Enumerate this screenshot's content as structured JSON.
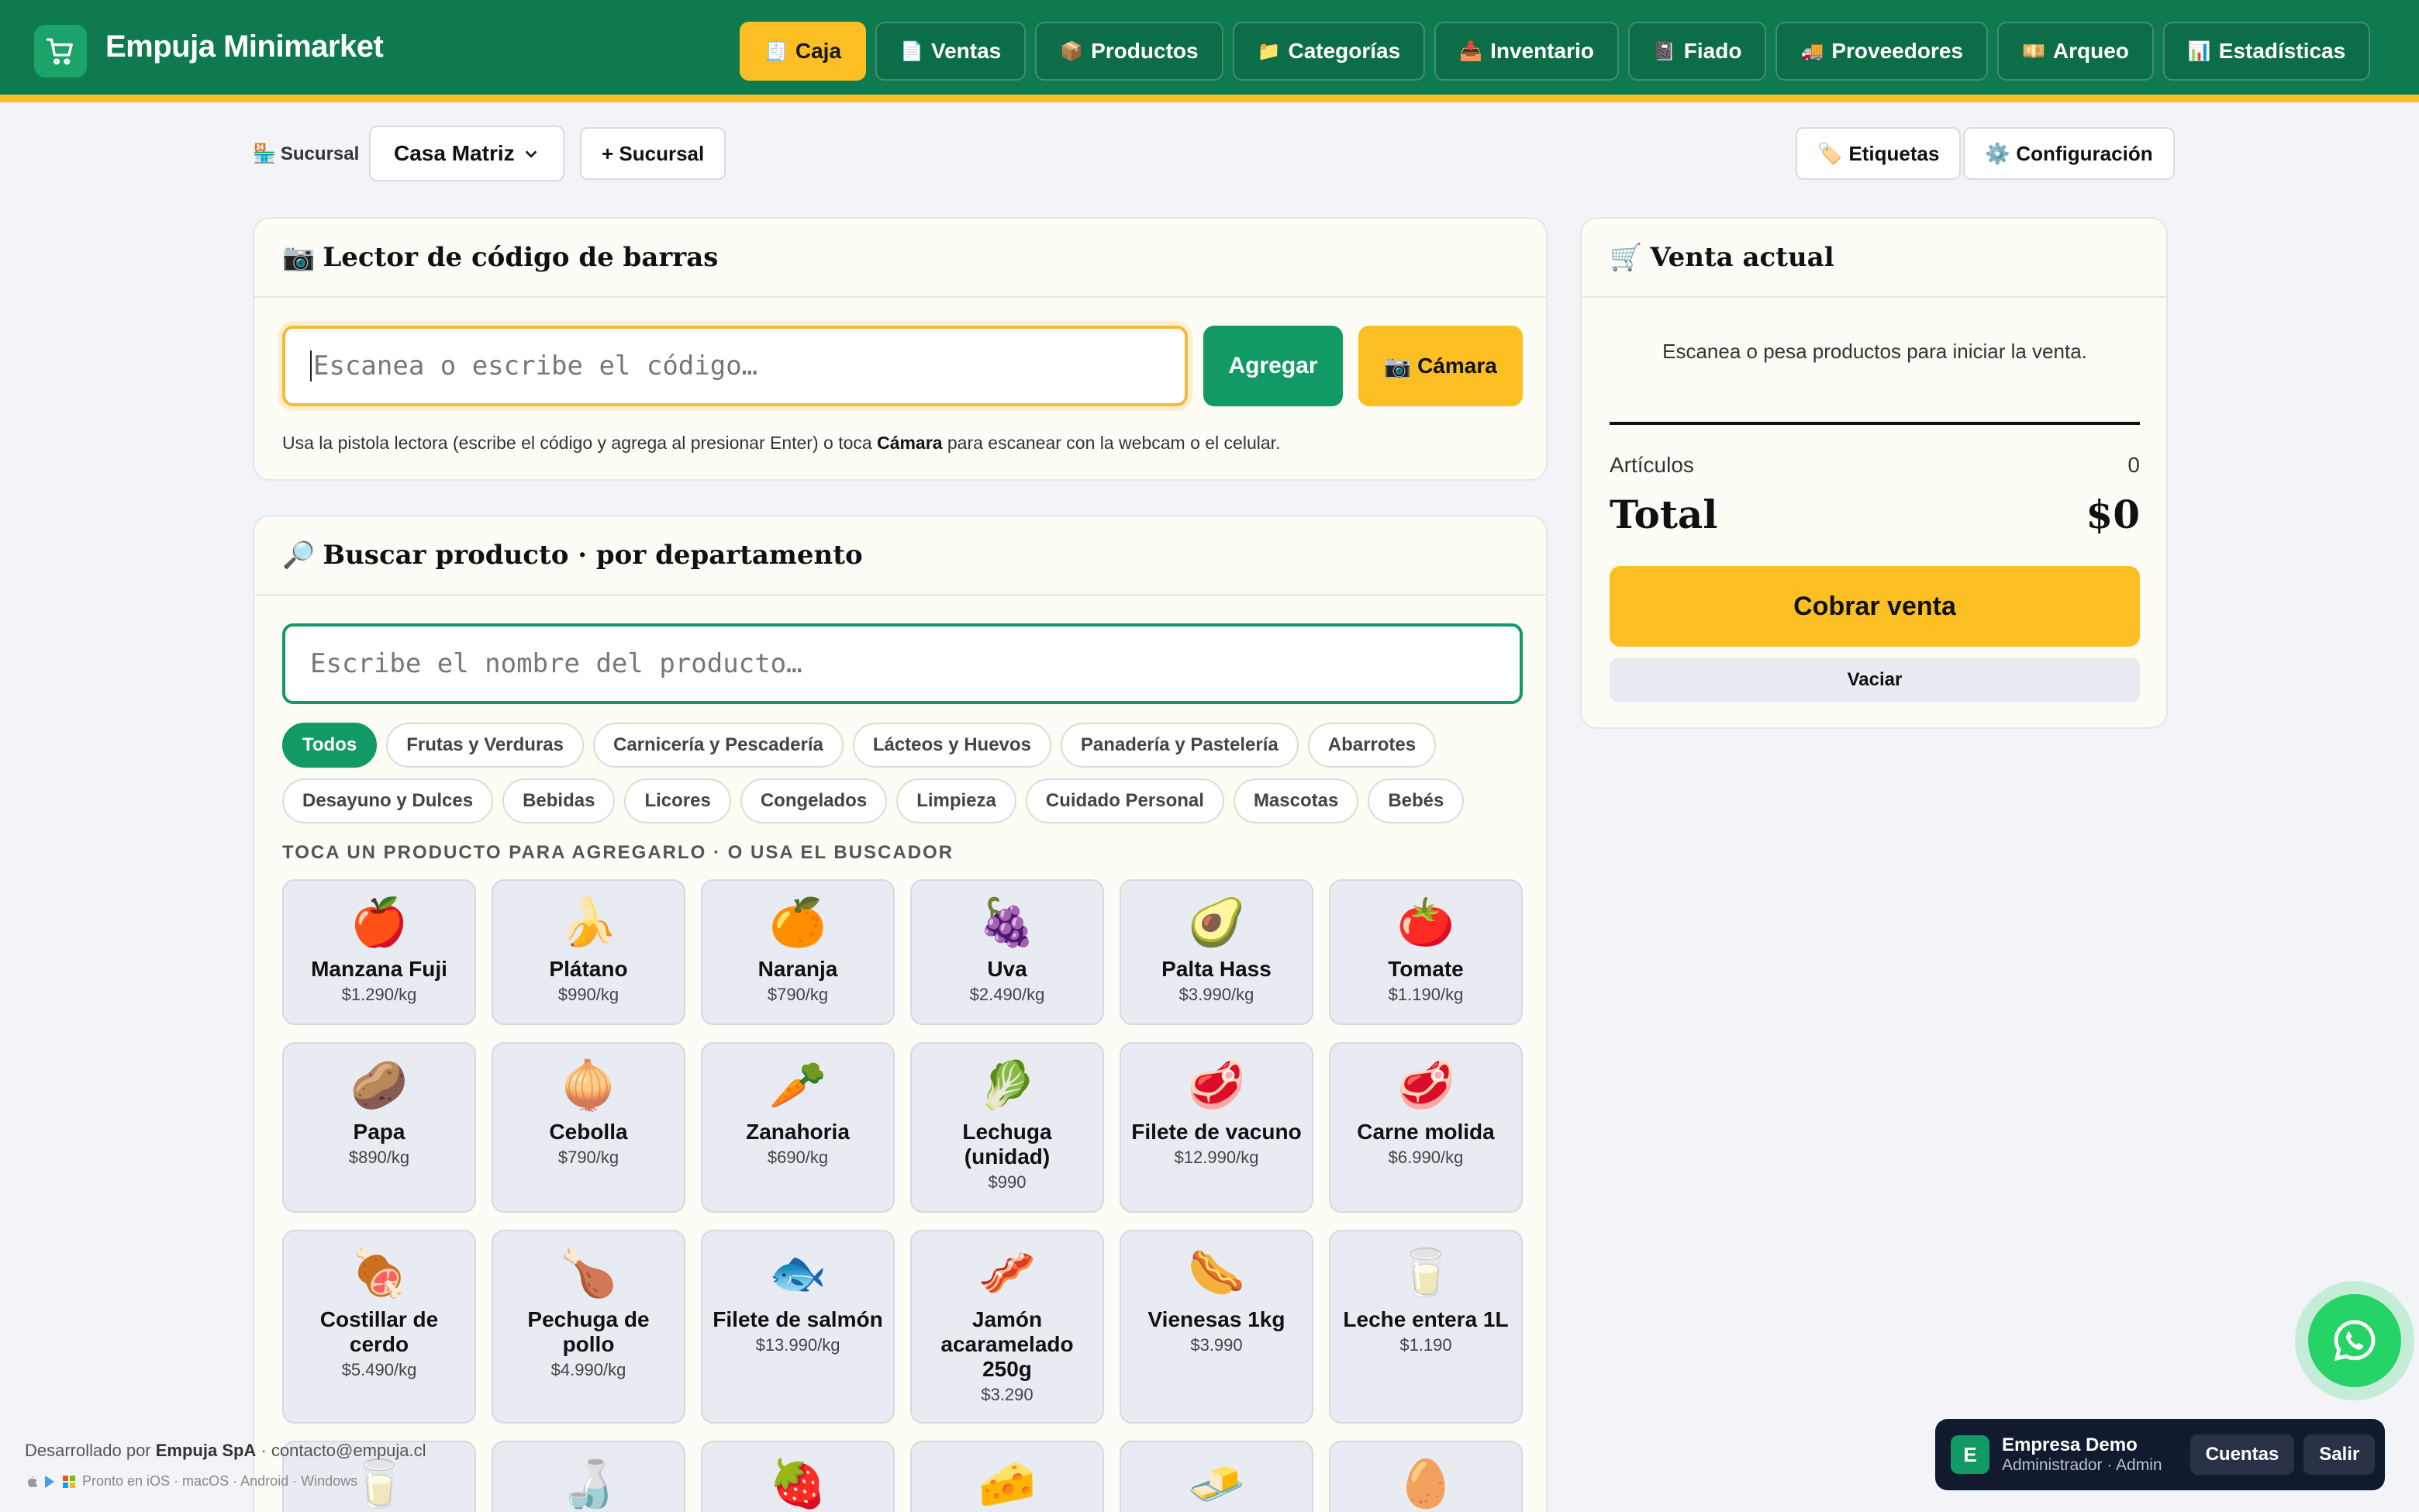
{
  "header": {
    "brand": "Empuja Minimarket",
    "nav": [
      {
        "icon": "🧾",
        "label": "Caja",
        "active": true
      },
      {
        "icon": "📄",
        "label": "Ventas"
      },
      {
        "icon": "📦",
        "label": "Productos"
      },
      {
        "icon": "📁",
        "label": "Categorías"
      },
      {
        "icon": "📥",
        "label": "Inventario"
      },
      {
        "icon": "📓",
        "label": "Fiado"
      },
      {
        "icon": "🚚",
        "label": "Proveedores"
      },
      {
        "icon": "💴",
        "label": "Arqueo"
      },
      {
        "icon": "📊",
        "label": "Estadísticas"
      }
    ]
  },
  "toolbar": {
    "branch_icon": "🏪",
    "branch_label": "Sucursal",
    "branch_value": "Casa Matriz",
    "add_branch": "+ Sucursal",
    "labels_icon": "🏷️",
    "labels_btn": "Etiquetas",
    "config_icon": "⚙️",
    "config_btn": "Configuración"
  },
  "scanner": {
    "icon": "📷",
    "title": "Lector de código de barras",
    "placeholder": "Escanea o escribe el código…",
    "add_btn": "Agregar",
    "cam_icon": "📷",
    "cam_btn": "Cámara",
    "help_before": "Usa la pistola lectora (escribe el código y agrega al presionar Enter) o toca ",
    "help_bold": "Cámara",
    "help_after": " para escanear con la webcam o el celular."
  },
  "search": {
    "icon": "🔎",
    "title": "Buscar producto · por departamento",
    "placeholder": "Escribe el nombre del producto…",
    "hint": "TOCA UN PRODUCTO PARA AGREGARLO · O USA EL BUSCADOR",
    "chips": [
      "Todos",
      "Frutas y Verduras",
      "Carnicería y Pescadería",
      "Lácteos y Huevos",
      "Panadería y Pastelería",
      "Abarrotes",
      "Desayuno y Dulces",
      "Bebidas",
      "Licores",
      "Congelados",
      "Limpieza",
      "Cuidado Personal",
      "Mascotas",
      "Bebés"
    ],
    "active_chip": 0,
    "products": [
      {
        "emoji": "🍎",
        "name": "Manzana Fuji",
        "price": "$1.290/kg"
      },
      {
        "emoji": "🍌",
        "name": "Plátano",
        "price": "$990/kg"
      },
      {
        "emoji": "🍊",
        "name": "Naranja",
        "price": "$790/kg"
      },
      {
        "emoji": "🍇",
        "name": "Uva",
        "price": "$2.490/kg"
      },
      {
        "emoji": "🥑",
        "name": "Palta Hass",
        "price": "$3.990/kg"
      },
      {
        "emoji": "🍅",
        "name": "Tomate",
        "price": "$1.190/kg"
      },
      {
        "emoji": "🥔",
        "name": "Papa",
        "price": "$890/kg"
      },
      {
        "emoji": "🧅",
        "name": "Cebolla",
        "price": "$790/kg"
      },
      {
        "emoji": "🥕",
        "name": "Zanahoria",
        "price": "$690/kg"
      },
      {
        "emoji": "🥬",
        "name": "Lechuga (unidad)",
        "price": "$990"
      },
      {
        "emoji": "🥩",
        "name": "Filete de vacuno",
        "price": "$12.990/kg"
      },
      {
        "emoji": "🥩",
        "name": "Carne molida",
        "price": "$6.990/kg"
      },
      {
        "emoji": "🍖",
        "name": "Costillar de cerdo",
        "price": "$5.490/kg"
      },
      {
        "emoji": "🍗",
        "name": "Pechuga de pollo",
        "price": "$4.990/kg"
      },
      {
        "emoji": "🐟",
        "name": "Filete de salmón",
        "price": "$13.990/kg"
      },
      {
        "emoji": "🥓",
        "name": "Jamón acaramelado 250g",
        "price": "$3.290"
      },
      {
        "emoji": "🌭",
        "name": "Vienesas 1kg",
        "price": "$3.990"
      },
      {
        "emoji": "🥛",
        "name": "Leche entera 1L",
        "price": "$1.190"
      },
      {
        "emoji": "🥛",
        "name": "",
        "price": ""
      },
      {
        "emoji": "🍶",
        "name": "",
        "price": ""
      },
      {
        "emoji": "🍓",
        "name": "",
        "price": ""
      },
      {
        "emoji": "🧀",
        "name": "",
        "price": ""
      },
      {
        "emoji": "🧈",
        "name": "",
        "price": ""
      },
      {
        "emoji": "🥚",
        "name": "",
        "price": ""
      }
    ]
  },
  "sale": {
    "icon": "🛒",
    "title": "Venta actual",
    "empty_text": "Escanea o pesa productos para iniciar la venta.",
    "articles_label": "Artículos",
    "articles_value": "0",
    "total_label": "Total",
    "total_value": "$0",
    "charge_btn": "Cobrar venta",
    "clear_btn": "Vaciar"
  },
  "footer": {
    "dev_prefix": "Desarrollado por ",
    "company": "Empuja SpA",
    "contact": " · contacto@empuja.cl",
    "platforms": "Pronto en iOS · macOS · Android · Windows"
  },
  "account": {
    "avatar": "E",
    "name": "Empresa Demo",
    "role": "Administrador · Admin",
    "accounts_btn": "Cuentas",
    "logout_btn": "Salir"
  }
}
